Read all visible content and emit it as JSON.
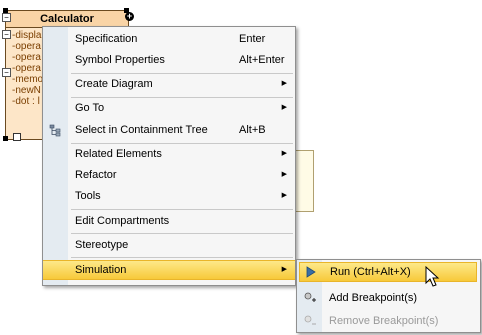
{
  "uml_class": {
    "name": "Calculator",
    "attributes": [
      "-displa",
      "-opera",
      "-opera",
      "-opera",
      "-memo",
      "-newN",
      "-dot : l"
    ]
  },
  "context_menu": {
    "items": [
      {
        "label": "Specification",
        "shortcut": "Enter"
      },
      {
        "label": "Symbol Properties",
        "shortcut": "Alt+Enter"
      },
      {
        "label": "Create Diagram",
        "submenu": true
      },
      {
        "label": "Go To",
        "submenu": true
      },
      {
        "label": "Select in Containment Tree",
        "shortcut": "Alt+B",
        "icon": "containment-tree-icon"
      },
      {
        "label": "Related Elements",
        "submenu": true
      },
      {
        "label": "Refactor",
        "submenu": true
      },
      {
        "label": "Tools",
        "submenu": true
      },
      {
        "label": "Edit Compartments"
      },
      {
        "label": "Stereotype"
      },
      {
        "label": "Simulation",
        "submenu": true,
        "highlighted": true
      }
    ]
  },
  "simulation_submenu": {
    "items": [
      {
        "label": "Run (Ctrl+Alt+X)",
        "icon": "play-icon",
        "highlighted": true
      },
      {
        "label": "Add Breakpoint(s)",
        "icon": "add-breakpoint-icon"
      },
      {
        "label": "Remove Breakpoint(s)",
        "icon": "remove-breakpoint-icon",
        "disabled": true
      }
    ]
  },
  "colors": {
    "highlight": "#f7c93a",
    "menu_background": "#f6f6f6",
    "gutter": "#e4ebf1",
    "class_fill": "#fde6c8",
    "disabled_text": "#9a9a9a"
  }
}
